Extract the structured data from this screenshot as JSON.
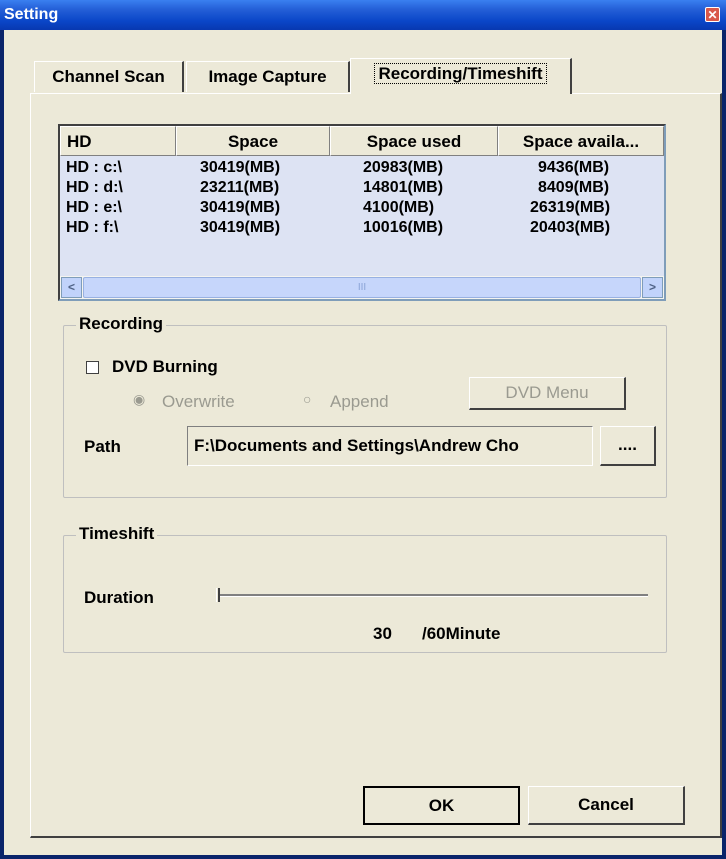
{
  "window": {
    "title": "Setting",
    "close_glyph": "✕"
  },
  "tabs": [
    "Channel Scan",
    "Image Capture",
    "Recording/Timeshift"
  ],
  "disk_list": {
    "columns": [
      "HD",
      "Space",
      "Space used",
      "Space availa..."
    ],
    "rows": [
      [
        "HD : c:\\",
        "30419(MB)",
        "20983(MB)",
        "9436(MB)"
      ],
      [
        "HD : d:\\",
        "23211(MB)",
        "14801(MB)",
        "8409(MB)"
      ],
      [
        "HD : e:\\",
        "30419(MB)",
        "4100(MB)",
        "26319(MB)"
      ],
      [
        "HD : f:\\",
        "30419(MB)",
        "10016(MB)",
        "20403(MB)"
      ]
    ],
    "scroll_left": "<",
    "scroll_right": ">",
    "thumb_grip": "III"
  },
  "recording": {
    "legend": "Recording",
    "dvd_burning_label": "DVD Burning",
    "dvd_burning_checked": false,
    "overwrite_label": "Overwrite",
    "append_label": "Append",
    "radio_selected_glyph": "◉",
    "radio_unselected_glyph": "○",
    "dvd_menu_label": "DVD Menu",
    "path_label": "Path",
    "path_value": "F:\\Documents and Settings\\Andrew Cho",
    "browse_label": "...."
  },
  "timeshift": {
    "legend": "Timeshift",
    "duration_label": "Duration",
    "duration_value": "30",
    "duration_suffix": "/60Minute",
    "slider_fraction": 0.0
  },
  "footer": {
    "ok_label": "OK",
    "cancel_label": "Cancel"
  },
  "colors": {
    "titlebar": "#0a46c8",
    "face": "#ece9d8",
    "list_bg": "#dde3f3"
  }
}
